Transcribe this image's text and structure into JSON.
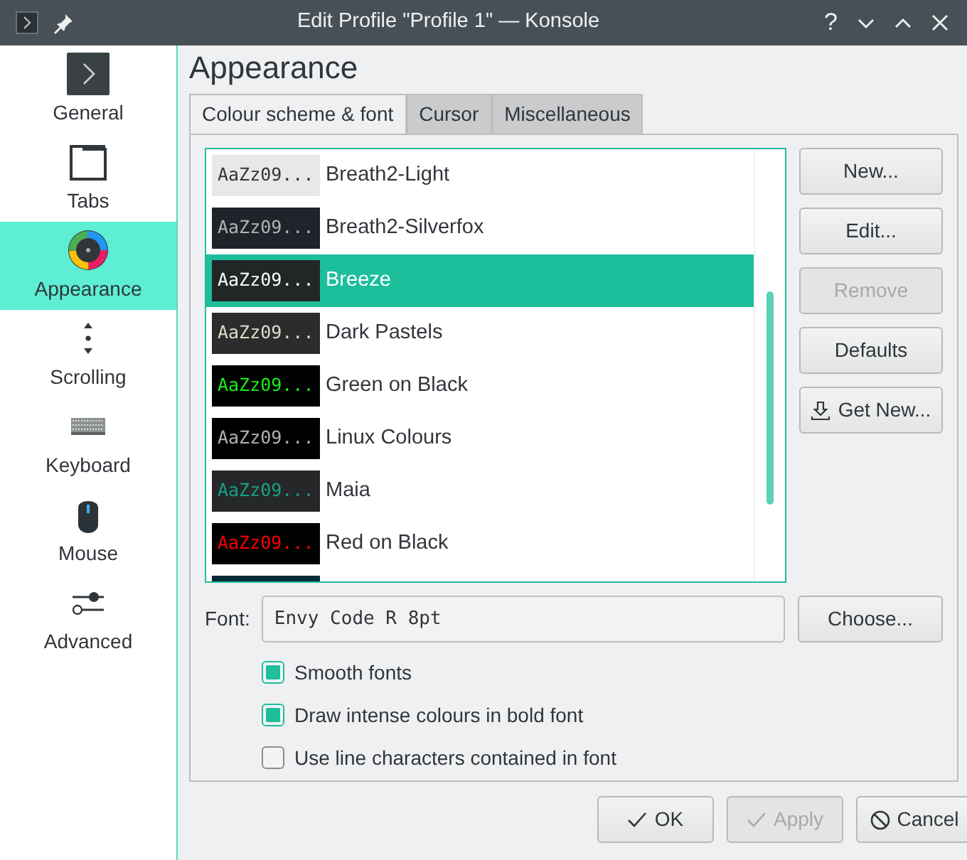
{
  "window": {
    "title": "Edit Profile \"Profile 1\" — Konsole",
    "help": "?"
  },
  "sidebar": {
    "items": [
      {
        "label": "General",
        "selected": false
      },
      {
        "label": "Tabs",
        "selected": false
      },
      {
        "label": "Appearance",
        "selected": true
      },
      {
        "label": "Scrolling",
        "selected": false
      },
      {
        "label": "Keyboard",
        "selected": false
      },
      {
        "label": "Mouse",
        "selected": false
      },
      {
        "label": "Advanced",
        "selected": false
      }
    ]
  },
  "heading": "Appearance",
  "tabs": [
    {
      "label": "Colour scheme & font",
      "selected": true
    },
    {
      "label": "Cursor",
      "selected": false
    },
    {
      "label": "Miscellaneous",
      "selected": false
    }
  ],
  "schemes": [
    {
      "kind": "full",
      "preview": "AaZz09...",
      "name": "Breath2-Light",
      "color": "#e8e8e8",
      "selected": false
    },
    {
      "kind": "full",
      "preview": "AaZz09...",
      "name": "Breath2-Silverfox",
      "color": "#1f232a",
      "selected": false
    },
    {
      "kind": "full",
      "preview": "AaZz09...",
      "name": "Breeze",
      "color": "#232627",
      "selected": true
    },
    {
      "kind": "full",
      "preview": "AaZz09...",
      "name": "Dark Pastels",
      "color": "#2c2c2c",
      "selected": false
    },
    {
      "kind": "full",
      "preview": "AaZz09...",
      "name": "Green on Black",
      "color": "#000000",
      "selected": false
    },
    {
      "kind": "full",
      "preview": "AaZz09...",
      "name": "Linux Colours",
      "color": "#000000",
      "selected": false
    },
    {
      "kind": "full",
      "preview": "AaZz09...",
      "name": "Maia",
      "color": "#262728",
      "selected": false
    },
    {
      "kind": "full",
      "preview": "AaZz09...",
      "name": "Red on Black",
      "color": "#000000",
      "selected": false
    },
    {
      "kind": "partial",
      "color": "#002b36"
    }
  ],
  "side_buttons": [
    {
      "label": "New...",
      "disabled": false,
      "kind": "plain"
    },
    {
      "label": "Edit...",
      "disabled": false,
      "kind": "plain"
    },
    {
      "label": "Remove",
      "disabled": true,
      "kind": "plain"
    },
    {
      "label": "Defaults",
      "disabled": false,
      "kind": "plain"
    },
    {
      "label": "Get New...",
      "disabled": false,
      "kind": "download"
    }
  ],
  "font": {
    "label": "Font:",
    "value": "Envy Code R 8pt",
    "button": "Choose..."
  },
  "options": [
    {
      "label": "Smooth fonts",
      "checked": true
    },
    {
      "label": "Draw intense colours in bold font",
      "checked": true
    },
    {
      "label": "Use line characters contained in font",
      "checked": false
    }
  ],
  "dialog_buttons": [
    {
      "label": "OK",
      "kind": "ok",
      "disabled": false
    },
    {
      "label": "Apply",
      "kind": "ok",
      "disabled": true
    },
    {
      "label": "Cancel",
      "kind": "cancel",
      "disabled": false
    }
  ]
}
